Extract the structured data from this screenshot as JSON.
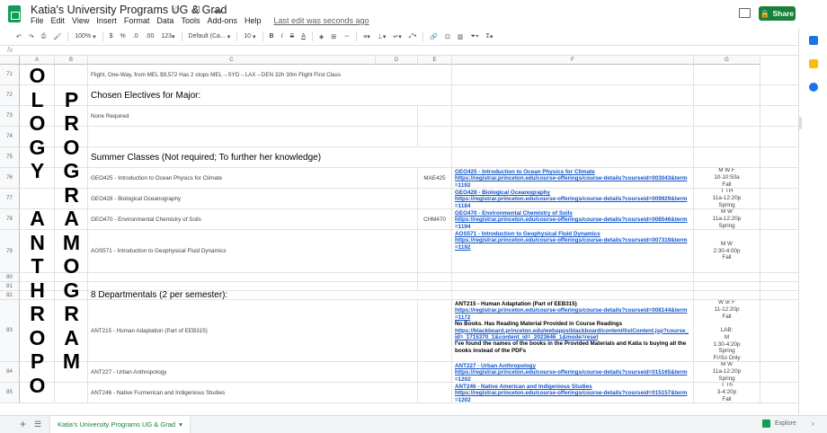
{
  "app": {
    "title": "Katia's University Programs UG & Grad",
    "menu": [
      "File",
      "Edit",
      "View",
      "Insert",
      "Format",
      "Data",
      "Tools",
      "Add-ons",
      "Help"
    ],
    "last_edit": "Last edit was seconds ago",
    "share_label": "Share",
    "title_icons": "☆ ⊡ ☁"
  },
  "toolbar": {
    "zoom": "100%",
    "currency": "$",
    "percent": "%",
    "dec_decrease": ".0",
    "dec_increase": ".00",
    "more_formats": "123",
    "font": "Default (Ca...",
    "font_size": "10",
    "bold": "B",
    "italic": "I",
    "strike": "S",
    "text_color": "A",
    "sum": "Σ"
  },
  "formula_bar": {
    "fx": "fx"
  },
  "columns": [
    "A",
    "B",
    "C",
    "D",
    "E",
    "F",
    "G"
  ],
  "vertical_text": {
    "col_a": [
      "O",
      "L",
      "O",
      "G",
      "Y",
      "",
      "A",
      "N",
      "T",
      "H",
      "R",
      "O",
      "P",
      "O"
    ],
    "col_b": [
      "",
      "P",
      "R",
      "O",
      "G",
      "R",
      "A",
      "M",
      "O",
      "G",
      "R",
      "A",
      "M"
    ]
  },
  "rows": [
    {
      "num": "71",
      "c": "Flight, One-Way, from MEL $9,572 Has 2 stops MEL→SYD→LAX→DEN 32h 30m Flight First Class",
      "e": "",
      "f": [],
      "g": []
    },
    {
      "num": "72",
      "c": "Chosen Electives for Major:",
      "e": "",
      "f": [],
      "g": []
    },
    {
      "num": "73",
      "c": "None Required",
      "e": "",
      "f": [],
      "g": []
    },
    {
      "num": "74",
      "c": "",
      "e": "",
      "f": [],
      "g": []
    },
    {
      "num": "75",
      "c": "Summer Classes (Not required; To further her knowledge)",
      "e": "",
      "f": [],
      "g": []
    },
    {
      "num": "76",
      "c": "GEO425 - Introduction to Ocean Physics for Climate",
      "e": "MAE425",
      "f": [
        "GEO425 - Introduction to Ocean Physics for Climate",
        "https://registrar.princeton.edu/course-offerings/course-details?courseid=003043&term",
        "=1192"
      ],
      "g": [
        "M W F",
        "10-10:50a",
        "Fall"
      ]
    },
    {
      "num": "77",
      "c": "GEO428 - Biological Oceanography",
      "e": "",
      "f": [
        "GEO428 - Biological Oceanography",
        "https://registrar.princeton.edu/course-offerings/course-details?courseid=009929&term",
        "=1184"
      ],
      "g": [
        "T TH",
        "11a-12:20p",
        "Spring"
      ]
    },
    {
      "num": "78",
      "c": "GEO470 - Environmental Chemistry of Soils",
      "e": "CHM470",
      "f": [
        "GEO470 - Environmental Chemistry of Soils",
        "https://registrar.princeton.edu/course-offerings/course-details?courseid=008546&term",
        "=1194"
      ],
      "g": [
        "M W",
        "11a-12:20p",
        "Spring"
      ]
    },
    {
      "num": "79",
      "c": "AOS571 - Introduction to Geophysical Fluid Dynamics",
      "e": "",
      "f": [
        "AOS571 - Introduction to Geophysical Fluid Dynamics",
        "https://registrar.princeton.edu/course-offerings/course-details?courseid=007319&term",
        "=1192"
      ],
      "g": [
        "M W",
        "2:30-4:00p",
        "Fall"
      ]
    },
    {
      "num": "80",
      "c": "",
      "e": "",
      "f": [],
      "g": []
    },
    {
      "num": "81",
      "c": "",
      "e": "",
      "f": [],
      "g": []
    },
    {
      "num": "82",
      "c": "8 Departmentals (2 per semester):",
      "e": "",
      "f": [],
      "g": []
    },
    {
      "num": "83",
      "c": "ANT215 - Human Adaptation (Part of EEB315)",
      "e": "",
      "f": [
        "ANT215 - Human Adaptation (Part of EEB315)",
        "https://registrar.princeton.edu/course-offerings/course-details?courseid=008144&term",
        "=1172",
        "No Books. Has Reading Material Provided in Course Readings",
        "https://blackboard.princeton.edu/webapps/blackboard/content/listContent.jsp?course_",
        "id=_1715370_1&content_id=_2023646_1&mode=reset",
        "I've found the names of the books in the Provided Materials and Katia is buying all the",
        "books instead of the PDFs"
      ],
      "g": [
        "W or F",
        "11-12:20p",
        "Fall",
        "",
        "LAB:",
        "M",
        "1:30-4:20p",
        "Spring",
        "Fr/So Only"
      ]
    },
    {
      "num": "84",
      "c": "ANT227 - Urban Anthropology",
      "e": "",
      "f": [
        "ANT227 - Urban Anthropology",
        "https://registrar.princeton.edu/course-offerings/course-details?courseid=015165&term",
        "=1202"
      ],
      "g": [
        "M W",
        "11a-12:20p",
        "Spring"
      ]
    },
    {
      "num": "85",
      "c": "ANT246 - Native Furmerican and Indigenious Studies",
      "e": "",
      "f": [
        "ANT246 - Native American and Indigenious Studies",
        "https://registrar.princeton.edu/course-offerings/course-details?courseid=015157&term",
        "=1202"
      ],
      "g": [
        "T Th",
        "3-4:20p",
        "Fall"
      ]
    }
  ],
  "sheet_tab": "Katia's University Programs UG & Grad",
  "explore_label": "Explore",
  "colors": {
    "accent": "#188038",
    "link": "#1155cc",
    "header_bg": "#f8f9fa"
  }
}
